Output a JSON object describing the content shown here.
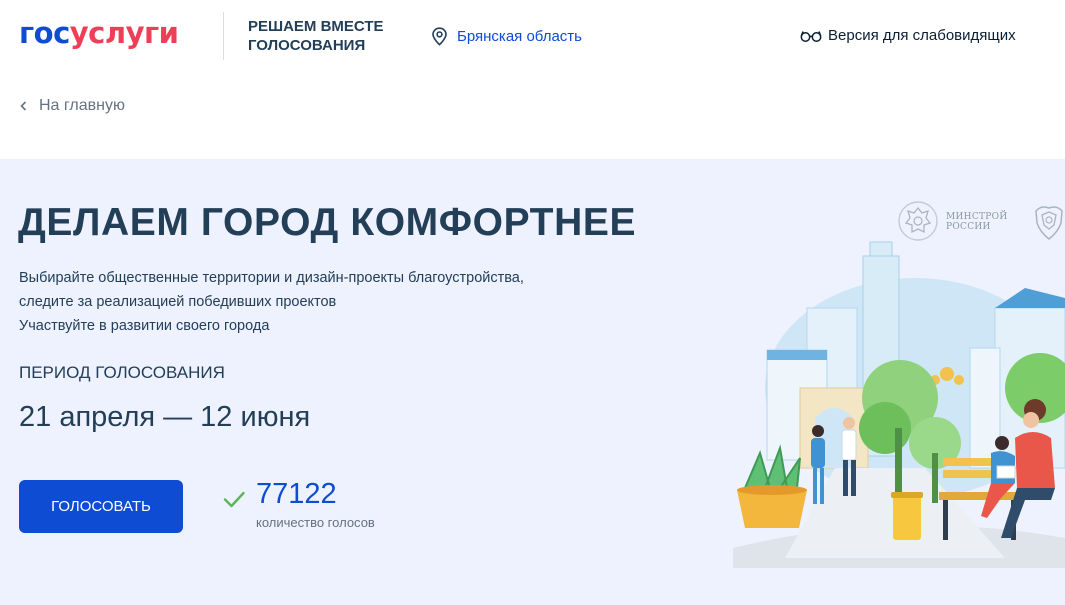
{
  "header": {
    "logo_part1": "гос",
    "logo_part2": "услуги",
    "project_title_line1": "Решаем вместе",
    "project_title_line2": "голосования",
    "region": "Брянская область",
    "low_vision": "Версия для слабовидящих"
  },
  "breadcrumb": {
    "back_label": "На главную"
  },
  "hero": {
    "title": "Делаем город комфортнее",
    "description_lines": [
      "Выбирайте общественные территории и дизайн-проекты благоустройства,",
      "следите за реализацией победивших проектов",
      "Участвуйте в развитии своего города"
    ],
    "period_label": "Период голосования",
    "period_value": "21 апреля — 12 июня",
    "vote_button": "Голосовать",
    "votes_count": "77122",
    "votes_label": "количество голосов"
  },
  "partners": {
    "minstroy_line1": "МИНСТРОЙ",
    "minstroy_line2": "РОССИИ"
  },
  "colors": {
    "brand_blue": "#0d4cd3",
    "brand_red": "#ee3f58",
    "hero_bg": "#edf2fe",
    "check_green": "#5bb55b"
  },
  "icons": [
    "location-pin-icon",
    "glasses-icon",
    "chevron-left-icon",
    "checkmark-icon",
    "coat-of-arms-icon"
  ]
}
